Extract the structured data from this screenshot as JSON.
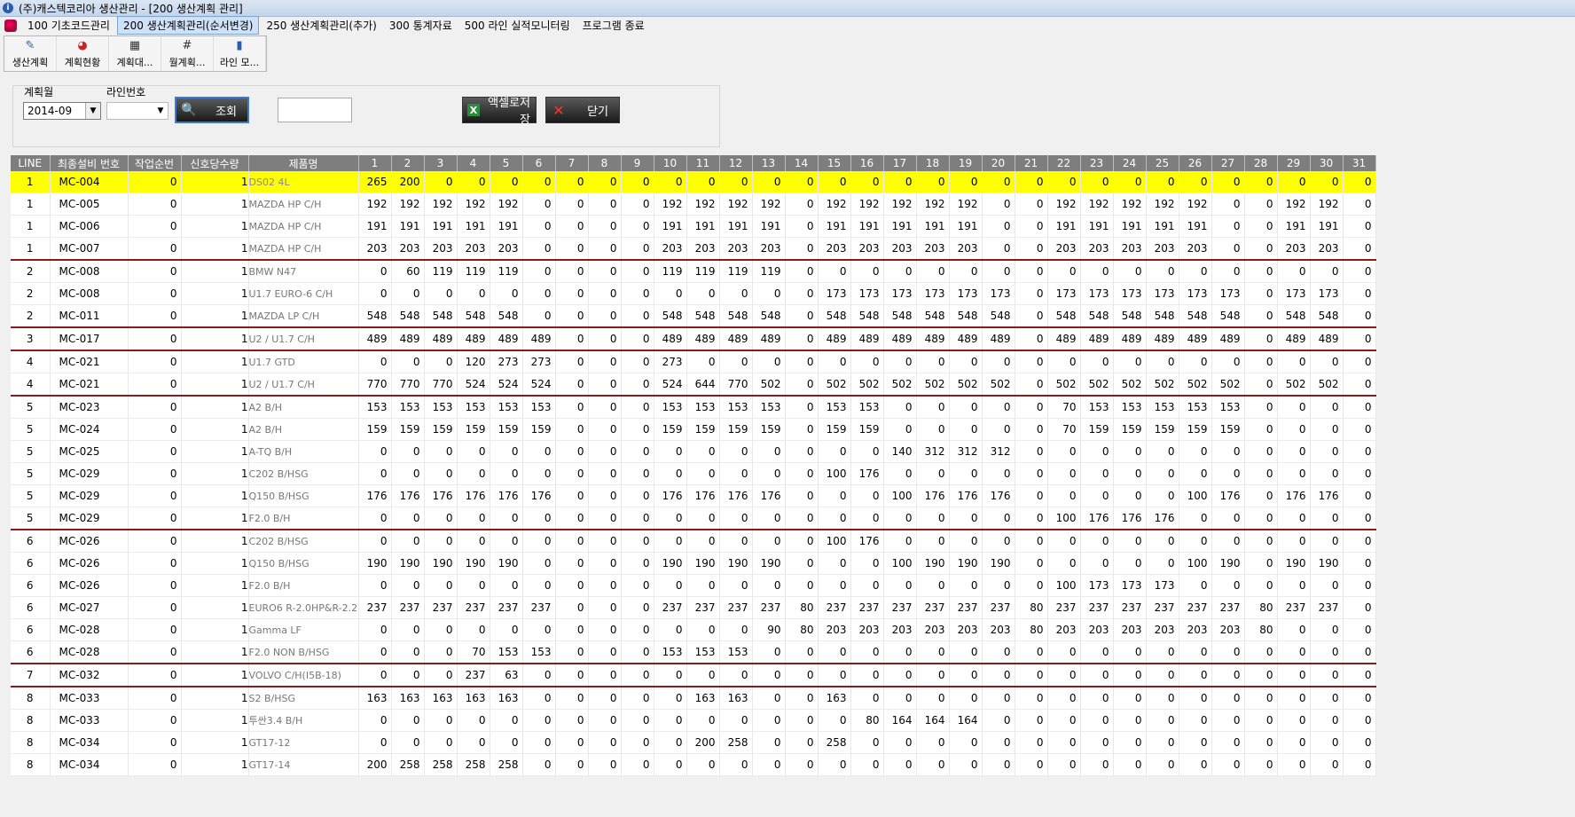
{
  "window": {
    "title": "(주)캐스텍코리아 생산관리 - [200 생산계획 관리]"
  },
  "menu": [
    {
      "label": "100 기초코드관리",
      "active": false
    },
    {
      "label": "200 생산계획관리(순서변경)",
      "active": true
    },
    {
      "label": "250 생산계획관리(추가)",
      "active": false
    },
    {
      "label": "300 통계자료",
      "active": false
    },
    {
      "label": "500 라인 실적모니터링",
      "active": false
    },
    {
      "label": "프로그램 종료",
      "active": false
    }
  ],
  "toolbar": [
    {
      "label": "생산계획",
      "icon": "pencil-chart-icon"
    },
    {
      "label": "계획현황",
      "icon": "color-wheel-icon"
    },
    {
      "label": "계획대...",
      "icon": "grid-table-icon"
    },
    {
      "label": "월계획...",
      "icon": "hash-grid-icon"
    },
    {
      "label": "라인 모...",
      "icon": "bar-chart-icon"
    }
  ],
  "filter": {
    "month_label": "계획월",
    "month_value": "2014-09",
    "line_label": "라인번호",
    "line_value": "",
    "search_label": "조회",
    "text_value": "",
    "excel_label": "액셀로저장",
    "close_label": "닫기"
  },
  "grid": {
    "headers": [
      "LINE",
      "최종설비 번호",
      "작업순번",
      "신호당수량",
      "제품명",
      "1",
      "2",
      "3",
      "4",
      "5",
      "6",
      "7",
      "8",
      "9",
      "10",
      "11",
      "12",
      "13",
      "14",
      "15",
      "16",
      "17",
      "18",
      "19",
      "20",
      "21",
      "22",
      "23",
      "24",
      "25",
      "26",
      "27",
      "28",
      "29",
      "30",
      "31"
    ],
    "rows": [
      {
        "line": "1",
        "mc": "MC-004",
        "seq": "0",
        "qty": "1",
        "product": "DS02 4L",
        "highlight": true,
        "days": [
          265,
          200,
          0,
          0,
          0,
          0,
          0,
          0,
          0,
          0,
          0,
          0,
          0,
          0,
          0,
          0,
          0,
          0,
          0,
          0,
          0,
          0,
          0,
          0,
          0,
          0,
          0,
          0,
          0,
          0,
          0
        ]
      },
      {
        "line": "1",
        "mc": "MC-005",
        "seq": "0",
        "qty": "1",
        "product": "MAZDA HP C/H",
        "days": [
          192,
          192,
          192,
          192,
          192,
          0,
          0,
          0,
          0,
          192,
          192,
          192,
          192,
          0,
          192,
          192,
          192,
          192,
          192,
          0,
          0,
          192,
          192,
          192,
          192,
          192,
          0,
          0,
          192,
          192,
          0
        ]
      },
      {
        "line": "1",
        "mc": "MC-006",
        "seq": "0",
        "qty": "1",
        "product": "MAZDA HP C/H",
        "days": [
          191,
          191,
          191,
          191,
          191,
          0,
          0,
          0,
          0,
          191,
          191,
          191,
          191,
          0,
          191,
          191,
          191,
          191,
          191,
          0,
          0,
          191,
          191,
          191,
          191,
          191,
          0,
          0,
          191,
          191,
          0
        ]
      },
      {
        "line": "1",
        "mc": "MC-007",
        "seq": "0",
        "qty": "1",
        "product": "MAZDA HP C/H",
        "days": [
          203,
          203,
          203,
          203,
          203,
          0,
          0,
          0,
          0,
          203,
          203,
          203,
          203,
          0,
          203,
          203,
          203,
          203,
          203,
          0,
          0,
          203,
          203,
          203,
          203,
          203,
          0,
          0,
          203,
          203,
          0
        ]
      },
      {
        "line": "2",
        "mc": "MC-008",
        "seq": "0",
        "qty": "1",
        "product": "BMW N47",
        "sep": true,
        "days": [
          0,
          60,
          119,
          119,
          119,
          0,
          0,
          0,
          0,
          119,
          119,
          119,
          119,
          0,
          0,
          0,
          0,
          0,
          0,
          0,
          0,
          0,
          0,
          0,
          0,
          0,
          0,
          0,
          0,
          0,
          0
        ]
      },
      {
        "line": "2",
        "mc": "MC-008",
        "seq": "0",
        "qty": "1",
        "product": "U1.7 EURO-6 C/H",
        "days": [
          0,
          0,
          0,
          0,
          0,
          0,
          0,
          0,
          0,
          0,
          0,
          0,
          0,
          0,
          173,
          173,
          173,
          173,
          173,
          173,
          0,
          173,
          173,
          173,
          173,
          173,
          173,
          0,
          173,
          173,
          0
        ]
      },
      {
        "line": "2",
        "mc": "MC-011",
        "seq": "0",
        "qty": "1",
        "product": "MAZDA LP C/H",
        "days": [
          548,
          548,
          548,
          548,
          548,
          0,
          0,
          0,
          0,
          548,
          548,
          548,
          548,
          0,
          548,
          548,
          548,
          548,
          548,
          548,
          0,
          548,
          548,
          548,
          548,
          548,
          548,
          0,
          548,
          548,
          0
        ]
      },
      {
        "line": "3",
        "mc": "MC-017",
        "seq": "0",
        "qty": "1",
        "product": "U2 / U1.7 C/H",
        "sep": true,
        "days": [
          489,
          489,
          489,
          489,
          489,
          489,
          0,
          0,
          0,
          489,
          489,
          489,
          489,
          0,
          489,
          489,
          489,
          489,
          489,
          489,
          0,
          489,
          489,
          489,
          489,
          489,
          489,
          0,
          489,
          489,
          0
        ]
      },
      {
        "line": "4",
        "mc": "MC-021",
        "seq": "0",
        "qty": "1",
        "product": "U1.7 GTD",
        "sep": true,
        "days": [
          0,
          0,
          0,
          120,
          273,
          273,
          0,
          0,
          0,
          273,
          0,
          0,
          0,
          0,
          0,
          0,
          0,
          0,
          0,
          0,
          0,
          0,
          0,
          0,
          0,
          0,
          0,
          0,
          0,
          0,
          0
        ]
      },
      {
        "line": "4",
        "mc": "MC-021",
        "seq": "0",
        "qty": "1",
        "product": "U2 / U1.7 C/H",
        "days": [
          770,
          770,
          770,
          524,
          524,
          524,
          0,
          0,
          0,
          524,
          644,
          770,
          502,
          0,
          502,
          502,
          502,
          502,
          502,
          502,
          0,
          502,
          502,
          502,
          502,
          502,
          502,
          0,
          502,
          502,
          0
        ]
      },
      {
        "line": "5",
        "mc": "MC-023",
        "seq": "0",
        "qty": "1",
        "product": "A2 B/H",
        "sep": true,
        "days": [
          153,
          153,
          153,
          153,
          153,
          153,
          0,
          0,
          0,
          153,
          153,
          153,
          153,
          0,
          153,
          153,
          0,
          0,
          0,
          0,
          0,
          70,
          153,
          153,
          153,
          153,
          153,
          0,
          0,
          0,
          0
        ]
      },
      {
        "line": "5",
        "mc": "MC-024",
        "seq": "0",
        "qty": "1",
        "product": "A2 B/H",
        "days": [
          159,
          159,
          159,
          159,
          159,
          159,
          0,
          0,
          0,
          159,
          159,
          159,
          159,
          0,
          159,
          159,
          0,
          0,
          0,
          0,
          0,
          70,
          159,
          159,
          159,
          159,
          159,
          0,
          0,
          0,
          0
        ]
      },
      {
        "line": "5",
        "mc": "MC-025",
        "seq": "0",
        "qty": "1",
        "product": "A-TQ B/H",
        "days": [
          0,
          0,
          0,
          0,
          0,
          0,
          0,
          0,
          0,
          0,
          0,
          0,
          0,
          0,
          0,
          0,
          140,
          312,
          312,
          312,
          0,
          0,
          0,
          0,
          0,
          0,
          0,
          0,
          0,
          0,
          0
        ]
      },
      {
        "line": "5",
        "mc": "MC-029",
        "seq": "0",
        "qty": "1",
        "product": "C202 B/HSG",
        "days": [
          0,
          0,
          0,
          0,
          0,
          0,
          0,
          0,
          0,
          0,
          0,
          0,
          0,
          0,
          100,
          176,
          0,
          0,
          0,
          0,
          0,
          0,
          0,
          0,
          0,
          0,
          0,
          0,
          0,
          0,
          0
        ]
      },
      {
        "line": "5",
        "mc": "MC-029",
        "seq": "0",
        "qty": "1",
        "product": "Q150 B/HSG",
        "days": [
          176,
          176,
          176,
          176,
          176,
          176,
          0,
          0,
          0,
          176,
          176,
          176,
          176,
          0,
          0,
          0,
          100,
          176,
          176,
          176,
          0,
          0,
          0,
          0,
          0,
          100,
          176,
          0,
          176,
          176,
          0
        ]
      },
      {
        "line": "5",
        "mc": "MC-029",
        "seq": "0",
        "qty": "1",
        "product": "F2.0 B/H",
        "days": [
          0,
          0,
          0,
          0,
          0,
          0,
          0,
          0,
          0,
          0,
          0,
          0,
          0,
          0,
          0,
          0,
          0,
          0,
          0,
          0,
          0,
          100,
          176,
          176,
          176,
          0,
          0,
          0,
          0,
          0,
          0
        ]
      },
      {
        "line": "6",
        "mc": "MC-026",
        "seq": "0",
        "qty": "1",
        "product": "C202 B/HSG",
        "sep": true,
        "days": [
          0,
          0,
          0,
          0,
          0,
          0,
          0,
          0,
          0,
          0,
          0,
          0,
          0,
          0,
          100,
          176,
          0,
          0,
          0,
          0,
          0,
          0,
          0,
          0,
          0,
          0,
          0,
          0,
          0,
          0,
          0
        ]
      },
      {
        "line": "6",
        "mc": "MC-026",
        "seq": "0",
        "qty": "1",
        "product": "Q150 B/HSG",
        "days": [
          190,
          190,
          190,
          190,
          190,
          0,
          0,
          0,
          0,
          190,
          190,
          190,
          190,
          0,
          0,
          0,
          100,
          190,
          190,
          190,
          0,
          0,
          0,
          0,
          0,
          100,
          190,
          0,
          190,
          190,
          0
        ]
      },
      {
        "line": "6",
        "mc": "MC-026",
        "seq": "0",
        "qty": "1",
        "product": "F2.0 B/H",
        "days": [
          0,
          0,
          0,
          0,
          0,
          0,
          0,
          0,
          0,
          0,
          0,
          0,
          0,
          0,
          0,
          0,
          0,
          0,
          0,
          0,
          0,
          100,
          173,
          173,
          173,
          0,
          0,
          0,
          0,
          0,
          0
        ]
      },
      {
        "line": "6",
        "mc": "MC-027",
        "seq": "0",
        "qty": "1",
        "product": "EURO6 R-2.0HP&R-2.2",
        "days": [
          237,
          237,
          237,
          237,
          237,
          237,
          0,
          0,
          0,
          237,
          237,
          237,
          237,
          80,
          237,
          237,
          237,
          237,
          237,
          237,
          80,
          237,
          237,
          237,
          237,
          237,
          237,
          80,
          237,
          237,
          0
        ]
      },
      {
        "line": "6",
        "mc": "MC-028",
        "seq": "0",
        "qty": "1",
        "product": "Gamma LF",
        "days": [
          0,
          0,
          0,
          0,
          0,
          0,
          0,
          0,
          0,
          0,
          0,
          0,
          90,
          80,
          203,
          203,
          203,
          203,
          203,
          203,
          80,
          203,
          203,
          203,
          203,
          203,
          203,
          80,
          0,
          0,
          0
        ]
      },
      {
        "line": "6",
        "mc": "MC-028",
        "seq": "0",
        "qty": "1",
        "product": "F2.0 NON B/HSG",
        "days": [
          0,
          0,
          0,
          70,
          153,
          153,
          0,
          0,
          0,
          153,
          153,
          153,
          0,
          0,
          0,
          0,
          0,
          0,
          0,
          0,
          0,
          0,
          0,
          0,
          0,
          0,
          0,
          0,
          0,
          0,
          0
        ]
      },
      {
        "line": "7",
        "mc": "MC-032",
        "seq": "0",
        "qty": "1",
        "product": "VOLVO C/H(I5B-18)",
        "sep": true,
        "days": [
          0,
          0,
          0,
          237,
          63,
          0,
          0,
          0,
          0,
          0,
          0,
          0,
          0,
          0,
          0,
          0,
          0,
          0,
          0,
          0,
          0,
          0,
          0,
          0,
          0,
          0,
          0,
          0,
          0,
          0,
          0
        ]
      },
      {
        "line": "8",
        "mc": "MC-033",
        "seq": "0",
        "qty": "1",
        "product": "S2 B/HSG",
        "sep": true,
        "days": [
          163,
          163,
          163,
          163,
          163,
          0,
          0,
          0,
          0,
          0,
          163,
          163,
          0,
          0,
          163,
          0,
          0,
          0,
          0,
          0,
          0,
          0,
          0,
          0,
          0,
          0,
          0,
          0,
          0,
          0,
          0
        ]
      },
      {
        "line": "8",
        "mc": "MC-033",
        "seq": "0",
        "qty": "1",
        "product": "투싼3.4 B/H",
        "days": [
          0,
          0,
          0,
          0,
          0,
          0,
          0,
          0,
          0,
          0,
          0,
          0,
          0,
          0,
          0,
          80,
          164,
          164,
          164,
          0,
          0,
          0,
          0,
          0,
          0,
          0,
          0,
          0,
          0,
          0,
          0
        ]
      },
      {
        "line": "8",
        "mc": "MC-034",
        "seq": "0",
        "qty": "1",
        "product": "GT17-12",
        "days": [
          0,
          0,
          0,
          0,
          0,
          0,
          0,
          0,
          0,
          0,
          200,
          258,
          0,
          0,
          258,
          0,
          0,
          0,
          0,
          0,
          0,
          0,
          0,
          0,
          0,
          0,
          0,
          0,
          0,
          0,
          0
        ]
      },
      {
        "line": "8",
        "mc": "MC-034",
        "seq": "0",
        "qty": "1",
        "product": "GT17-14",
        "days": [
          200,
          258,
          258,
          258,
          258,
          0,
          0,
          0,
          0,
          0,
          0,
          0,
          0,
          0,
          0,
          0,
          0,
          0,
          0,
          0,
          0,
          0,
          0,
          0,
          0,
          0,
          0,
          0,
          0,
          0,
          0
        ]
      }
    ]
  }
}
